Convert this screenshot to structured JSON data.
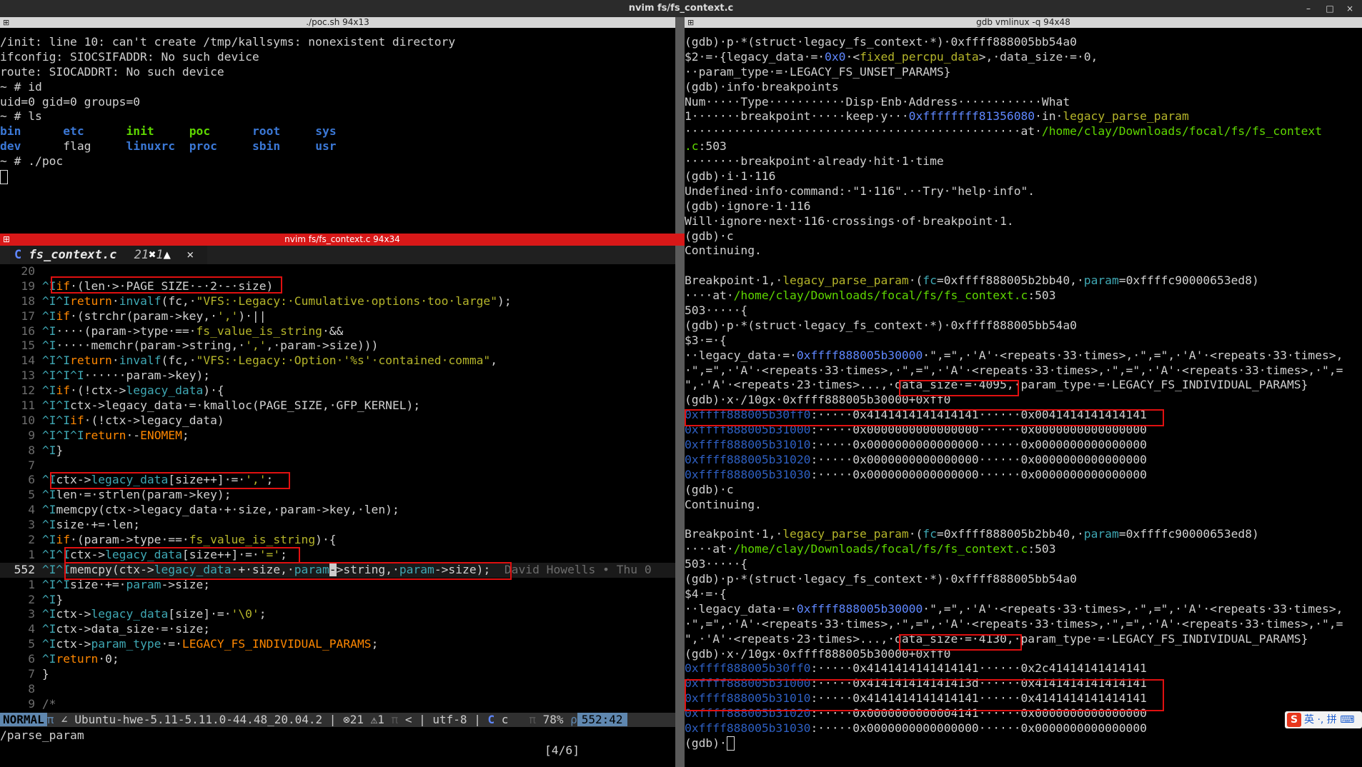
{
  "window": {
    "title": "nvim fs/fs_context.c",
    "minimize": "–",
    "maximize": "□",
    "close": "×"
  },
  "left_top": {
    "title": "./poc.sh 94x13",
    "lines": [
      "/init: line 10: can't create /tmp/kallsyms: nonexistent directory",
      "ifconfig: SIOCSIFADDR: No such device",
      "route: SIOCADDRT: No such device",
      "~ # id",
      "uid=0 gid=0 groups=0",
      "~ # ls"
    ],
    "ls_row1": [
      "bin",
      "etc",
      "init",
      "poc",
      "root",
      "sys"
    ],
    "ls_row2": [
      "dev",
      "flag",
      "linuxrc",
      "proc",
      "sbin",
      "usr"
    ],
    "prompt": "~ # ./poc"
  },
  "nvim": {
    "title": "nvim fs/fs_context.c 94x34",
    "tab": {
      "icon": "C",
      "name": "fs_context.c",
      "count": "21",
      "err_icon": "✖",
      "warn": "1",
      "warn_icon": "▲",
      "close": "×"
    },
    "blame": "David Howells • Thu 0",
    "status": {
      "mode": "NORMAL",
      "sep1": "π",
      "branch_icon": "∠",
      "branch": "Ubuntu-hwe-5.11-5.11.0-44.48_20.04.2",
      "sep2": "|",
      "err_icon": "⊗",
      "errors": "21",
      "warn_icon": "⚠",
      "warnings": "1",
      "sep3": "π",
      "lt": "<",
      "sep4": "|",
      "encoding": "utf-8",
      "sep5": "|",
      "ft_icon": "C",
      "filetype": "c",
      "sep6": "π",
      "percent": "78%",
      "sep7": "ρ",
      "position": "552:42"
    },
    "cmdline": "/parse_param",
    "search_count": "[4/6]"
  },
  "gdb": {
    "title": "gdb vmlinux -q 94x48"
  }
}
